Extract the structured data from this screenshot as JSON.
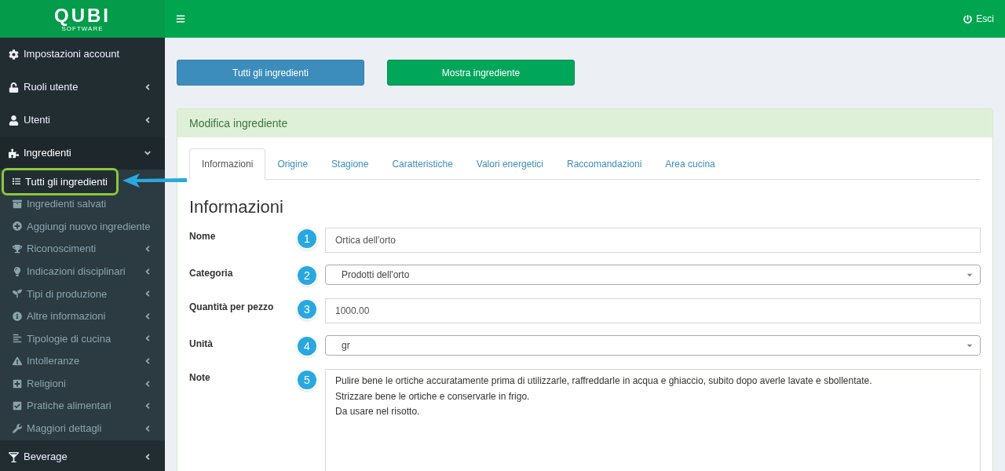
{
  "logo": {
    "name": "QUBI",
    "tagline": "SOFTWARE"
  },
  "header": {
    "logout": "Esci"
  },
  "sidebar": {
    "items": [
      {
        "label": "Impostazioni account",
        "has_arrow": false,
        "expanded": false
      },
      {
        "label": "Ruoli utente",
        "has_arrow": true,
        "expanded": false
      },
      {
        "label": "Utenti",
        "has_arrow": true,
        "expanded": false
      },
      {
        "label": "Ingredienti",
        "has_arrow": true,
        "expanded": true,
        "children": [
          {
            "label": "Tutti gli ingredienti",
            "has_arrow": false,
            "selected": true
          },
          {
            "label": "Ingredienti salvati",
            "has_arrow": false,
            "selected": false
          },
          {
            "label": "Aggiungi nuovo ingrediente",
            "has_arrow": false,
            "selected": false
          },
          {
            "label": "Riconoscimenti",
            "has_arrow": true,
            "selected": false
          },
          {
            "label": "Indicazioni disciplinari",
            "has_arrow": true,
            "selected": false
          },
          {
            "label": "Tipi di produzione",
            "has_arrow": true,
            "selected": false
          },
          {
            "label": "Altre informazioni",
            "has_arrow": true,
            "selected": false
          },
          {
            "label": "Tipologie di cucina",
            "has_arrow": true,
            "selected": false
          },
          {
            "label": "Intolleranze",
            "has_arrow": true,
            "selected": false
          },
          {
            "label": "Religioni",
            "has_arrow": true,
            "selected": false
          },
          {
            "label": "Pratiche alimentari",
            "has_arrow": true,
            "selected": false
          },
          {
            "label": "Maggiori dettagli",
            "has_arrow": true,
            "selected": false
          }
        ]
      },
      {
        "label": "Beverage",
        "has_arrow": true,
        "expanded": false
      }
    ]
  },
  "buttons": [
    {
      "label": "Tutti gli ingredienti",
      "kind": "primary"
    },
    {
      "label": "Mostra ingrediente",
      "kind": "success"
    }
  ],
  "panel": {
    "title": "Modifica ingrediente",
    "tabs": [
      {
        "label": "Informazioni",
        "selected": true
      },
      {
        "label": "Origine",
        "selected": false
      },
      {
        "label": "Stagione",
        "selected": false
      },
      {
        "label": "Caratteristiche",
        "selected": false
      },
      {
        "label": "Valori energetici",
        "selected": false
      },
      {
        "label": "Raccomandazioni",
        "selected": false
      },
      {
        "label": "Area cucina",
        "selected": false
      }
    ],
    "section_title": "Informazioni",
    "fields": [
      {
        "label": "Nome",
        "step": "1",
        "kind": "text",
        "value": "Ortica dell'orto"
      },
      {
        "label": "Categoria",
        "step": "2",
        "kind": "select",
        "value": "Prodotti dell'orto"
      },
      {
        "label": "Quantità per pezzo",
        "step": "3",
        "kind": "text",
        "value": "1000.00"
      },
      {
        "label": "Unità",
        "step": "4",
        "kind": "select",
        "value": "gr"
      },
      {
        "label": "Note",
        "step": "5",
        "kind": "textarea",
        "value": "Pulire bene le ortiche accuratamente prima di utilizzarle, raffreddarle in acqua e ghiaccio, subito dopo averle lavate e sbollentate.\nStrizzare bene le ortiche e conservarle in frigo.\nDa usare nel risotto."
      }
    ]
  }
}
